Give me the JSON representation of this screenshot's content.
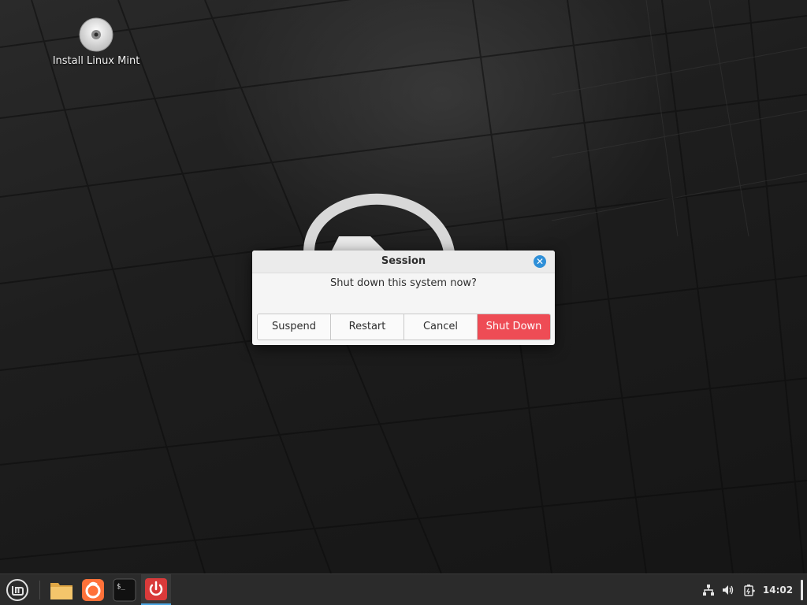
{
  "desktop": {
    "icons": [
      {
        "label": "Install Linux Mint",
        "icon": "cd-disc-icon"
      }
    ]
  },
  "dialog": {
    "title": "Session",
    "message": "Shut down this system now?",
    "buttons": {
      "suspend": "Suspend",
      "restart": "Restart",
      "cancel": "Cancel",
      "shutdown": "Shut Down"
    },
    "colors": {
      "shutdown_bg": "#ee4c55",
      "close_bg": "#2e8fd8"
    }
  },
  "taskbar": {
    "launchers": [
      "mint-menu-icon",
      "folder-icon",
      "firefox-icon",
      "terminal-icon",
      "power-icon"
    ],
    "tray": {
      "icons": [
        "network-icon",
        "volume-icon",
        "battery-icon"
      ],
      "clock": "14:02"
    }
  }
}
